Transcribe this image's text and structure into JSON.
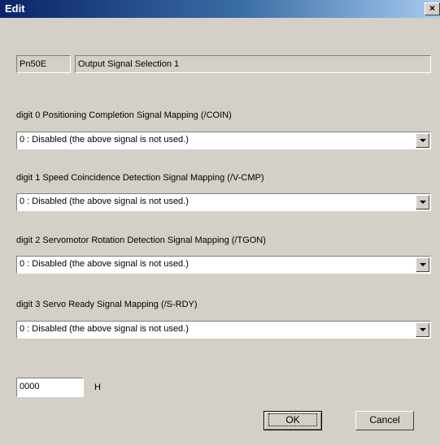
{
  "window": {
    "title": "Edit",
    "close_glyph": "×"
  },
  "parameter": {
    "number": "Pn50E",
    "name": "Output Signal Selection 1"
  },
  "digits": [
    {
      "label": "digit 0  Positioning Completion Signal Mapping (/COIN)",
      "selected": "0 : Disabled (the above signal is not used.)"
    },
    {
      "label": "digit 1  Speed Coincidence Detection Signal Mapping (/V-CMP)",
      "selected": "0 : Disabled (the above signal is not used.)"
    },
    {
      "label": "digit 2  Servomotor Rotation Detection Signal Mapping (/TGON)",
      "selected": "0 : Disabled (the above signal is not used.)"
    },
    {
      "label": "digit 3  Servo Ready Signal Mapping (/S-RDY)",
      "selected": "0 : Disabled (the above signal is not used.)"
    }
  ],
  "value": {
    "hex": "0000",
    "unit": "H"
  },
  "buttons": {
    "ok": "OK",
    "cancel": "Cancel"
  },
  "icons": {
    "dropdown": "chevron-down-icon",
    "close": "close-icon"
  }
}
